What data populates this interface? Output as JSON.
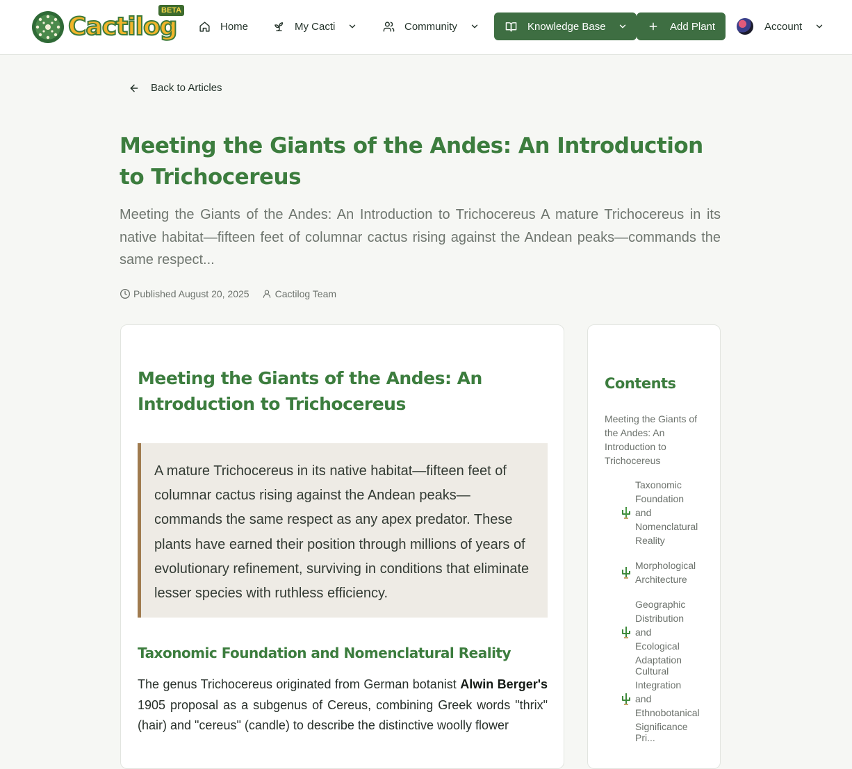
{
  "brand": {
    "name": "Cactilog",
    "badge": "BETA"
  },
  "nav": {
    "home": "Home",
    "my_cacti": "My Cacti",
    "community": "Community",
    "knowledge_base": "Knowledge Base",
    "add_plant": "Add Plant",
    "account": "Account"
  },
  "page": {
    "back_label": "Back to Articles",
    "title": "Meeting the Giants of the Andes: An Introduction to Trichocereus",
    "excerpt": "Meeting the Giants of the Andes: An Introduction to Trichocereus A mature Trichocereus in its native habitat—fifteen feet of columnar cactus rising against the Andean peaks—commands the same respect...",
    "published": "Published August 20, 2025",
    "author": "Cactilog Team"
  },
  "article": {
    "title": "Meeting the Giants of the Andes: An Introduction to Trichocereus",
    "quote": "A mature Trichocereus in its native habitat—fifteen feet of columnar cactus rising against the Andean peaks—commands the same respect as any apex predator. These plants have earned their position through millions of years of evolutionary refinement, surviving in conditions that eliminate lesser species with ruthless efficiency.",
    "section1_heading": "Taxonomic Foundation and Nomenclatural Reality",
    "para_start": "The genus Trichocereus originated from German botanist ",
    "para_bold": "Alwin Berger's",
    "para_rest": " 1905 proposal as a subgenus of Cereus, combining Greek words \"thrix\" (hair) and \"cereus\" (candle) to describe the distinctive woolly flower"
  },
  "toc": {
    "title": "Contents",
    "main": "Meeting the Giants of the Andes: An Introduction to Trichocereus",
    "items": [
      "Taxonomic Foundation and Nomenclatural Reality",
      "Morphological Architecture",
      "Geographic Distribution and Ecological Adaptation",
      "Cultural Integration and Ethnobotanical Significance",
      "Pri..."
    ]
  },
  "colors": {
    "brand_green": "#3e6e42",
    "heading_green": "#3c7d3e",
    "quote_border": "#a07b4f",
    "page_bg": "#f6f7f4"
  },
  "icons": [
    "home-icon",
    "sprout-icon",
    "users-icon",
    "book-icon",
    "plus-icon",
    "chevron-down-icon",
    "arrow-left-icon",
    "clock-icon",
    "user-icon",
    "cactus-icon"
  ]
}
